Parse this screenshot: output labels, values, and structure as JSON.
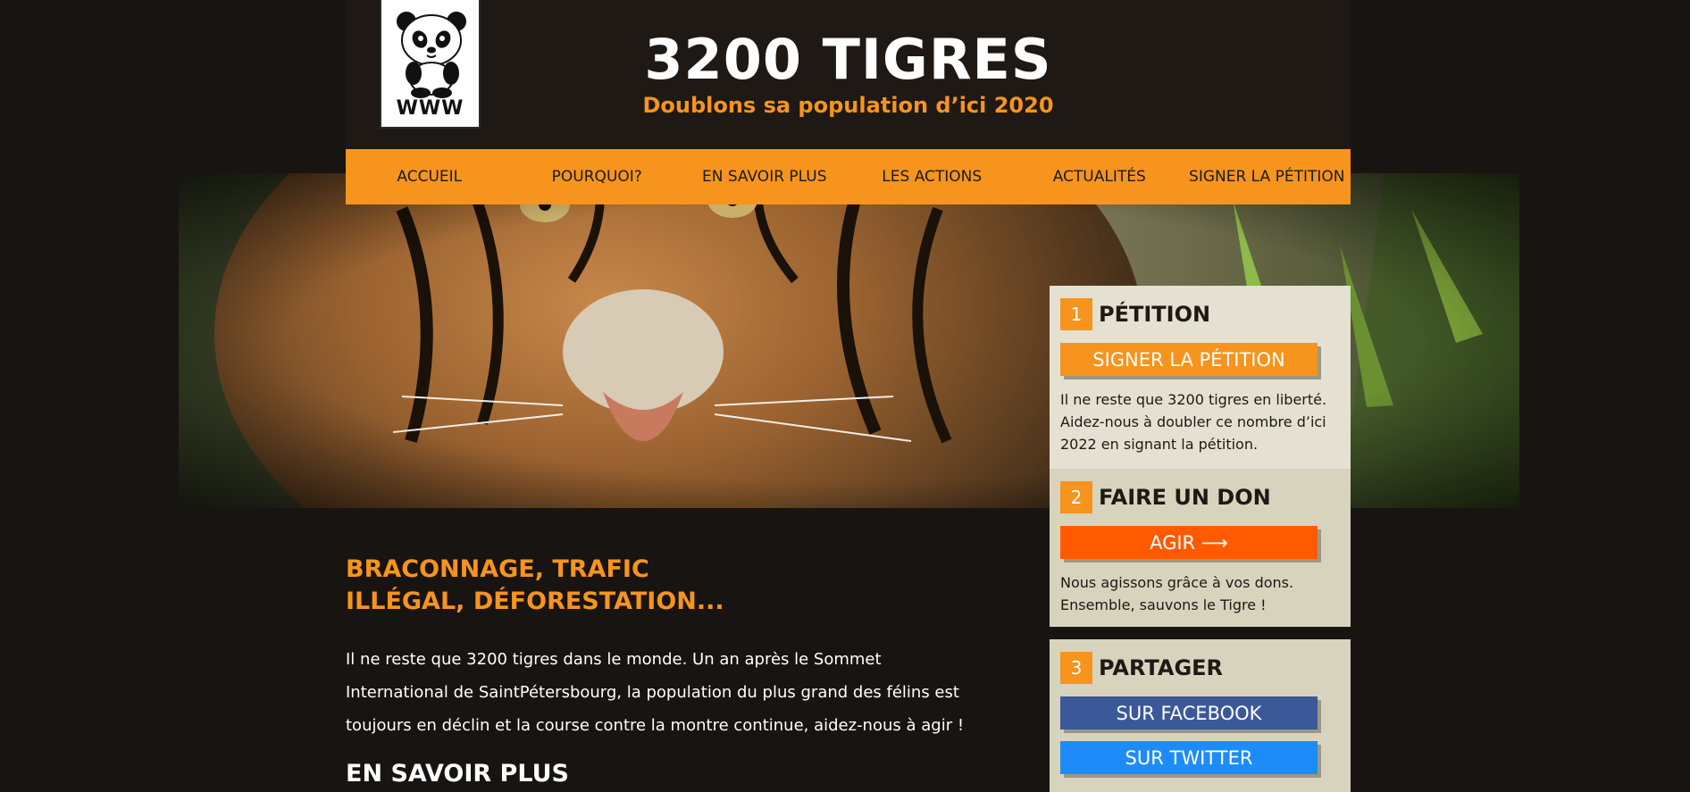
{
  "header": {
    "logo_caption": "WWW",
    "title": "3200 TIGRES",
    "subtitle": "Doublons sa population d’ici 2020"
  },
  "nav": {
    "items": [
      {
        "label": "ACCUEIL"
      },
      {
        "label": "POURQUOI?"
      },
      {
        "label": "EN SAVOIR PLUS"
      },
      {
        "label": "LES ACTIONS"
      },
      {
        "label": "ACTUALITÉS"
      },
      {
        "label": "SIGNER LA PÉTITION"
      }
    ]
  },
  "sidebar": {
    "petition": {
      "number": "1",
      "title": "PÉTITION",
      "button": "SIGNER LA PÉTITION",
      "text": "Il ne reste que 3200 tigres en liberté. Aidez-nous à doubler ce nombre d’ici 2022 en signant la pétition."
    },
    "don": {
      "number": "2",
      "title": "FAIRE UN DON",
      "button": "AGIR ⟶",
      "text": "Nous agissons grâce à vos dons. Ensemble, sauvons le Tigre !"
    },
    "partager": {
      "number": "3",
      "title": "PARTAGER",
      "facebook": "SUR FACEBOOK",
      "twitter": "SUR TWITTER"
    }
  },
  "main": {
    "headline": "BRACONNAGE, TRAFIC ILLÉGAL, DÉFORESTATION...",
    "intro": "Il ne reste que 3200 tigres dans le monde. Un an après le Sommet International de SaintPétersbourg, la population du plus grand des félins est toujours en déclin et la course contre la montre continue, aidez-nous à agir !",
    "section_title": "EN SAVOIR PLUS"
  },
  "colors": {
    "accent": "#f7941d",
    "don": "#ff5a00",
    "facebook": "#3b5998",
    "twitter": "#1d8cf8",
    "background": "#181411"
  }
}
